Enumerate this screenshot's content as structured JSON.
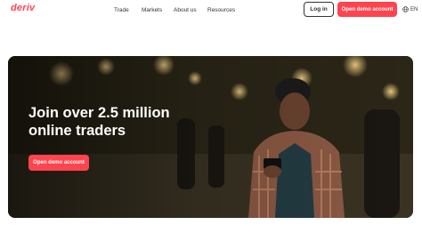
{
  "header": {
    "logo": "deriv",
    "nav": [
      "Trade",
      "Markets",
      "About us",
      "Resources"
    ],
    "login_label": "Log in",
    "signup_label": "Open demo account",
    "language": "EN",
    "icons": {
      "language": "globe-icon"
    }
  },
  "hero": {
    "headline": "Join over 2.5 million online traders",
    "cta_label": "Open demo account"
  },
  "colors": {
    "brand": "#ff444f",
    "text": "#333333"
  }
}
